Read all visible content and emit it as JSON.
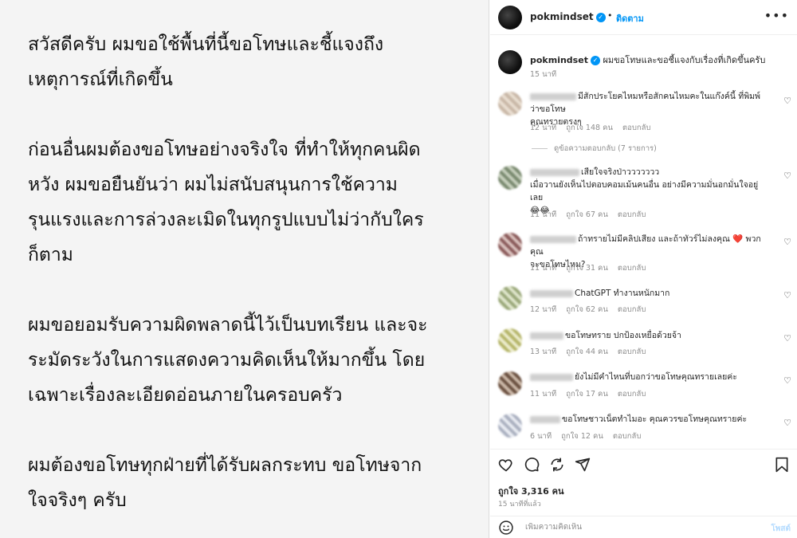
{
  "post_image": {
    "paragraphs": [
      [
        "สวัสดีครับ ผมขอใช้พื้นที่นี้ขอโทษและชี้แจงถึง",
        "เหตุการณ์ที่เกิดขึ้น"
      ],
      [
        "ก่อนอื่นผมต้องขอโทษอย่างจริงใจ ที่ทำให้ทุกคนผิด",
        "หวัง ผมขอยืนยันว่า ผมไม่สนับสนุนการใช้ความ",
        "รุนแรงและการล่วงละเมิดในทุกรูปแบบไม่ว่ากับใคร",
        "ก็ตาม"
      ],
      [
        "ผมขอยอมรับความผิดพลาดนี้ไว้เป็นบทเรียน และจะ",
        "ระมัดระวังในการแสดงความคิดเห็นให้มากขึ้น โดย",
        "เฉพาะเรื่องละเอียดอ่อนภายในครอบครัว"
      ],
      [
        "ผมต้องขอโทษทุกฝ่ายที่ได้รับผลกระทบ ขอโทษจาก",
        "ใจจริงๆ ครับ"
      ]
    ]
  },
  "header": {
    "username": "pokmindset",
    "separator": "•",
    "follow_label": "ติดตาม",
    "more": "•••"
  },
  "caption": {
    "username": "pokmindset",
    "text": "ผมขอโทษและขอชี้แจงกับเรื่องที่เกิดขึ้นครับ",
    "time": "15 นาที"
  },
  "comments": [
    {
      "lines": [
        "มีสักประโยคไหมหรือสักคนไหมคะในแก๊งค์นี้ ที่พิมพ์ว่าขอโทษ",
        "คุณทรายตรงๆ"
      ],
      "time": "12 นาที",
      "likes": "ถูกใจ 148 คน",
      "reply": "ตอบกลับ"
    },
    {
      "lines": [
        "เสียใจจริงป่าววววววว",
        "เมื่อวานยังเห็นไปตอบคอมเม้นคนอื่น อย่างมีความมั่นอกมั่นใจอยู่เลย",
        "😂😂"
      ],
      "time": "11 นาที",
      "likes": "ถูกใจ 67 คน",
      "reply": "ตอบกลับ"
    },
    {
      "lines": [
        "ถ้าทรายไม่มีคลิปเสียง และถ้าทัวร์ไม่ลงคุณ ❤️ พวกคุณ",
        "จะขอโทษไหม?"
      ],
      "time": "11 นาที",
      "likes": "ถูกใจ 31 คน",
      "reply": "ตอบกลับ"
    },
    {
      "lines": [
        "ChatGPT ทำงานหนักมาก"
      ],
      "time": "12 นาที",
      "likes": "ถูกใจ 62 คน",
      "reply": "ตอบกลับ"
    },
    {
      "lines": [
        "ขอโทษทราย ปกป้องเหยื่อด้วยจ้า"
      ],
      "time": "13 นาที",
      "likes": "ถูกใจ 44 คน",
      "reply": "ตอบกลับ"
    },
    {
      "lines": [
        "ยังไม่มีคำไหนที่บอกว่าขอโทษคุณทรายเลยค่ะ"
      ],
      "time": "11 นาที",
      "likes": "ถูกใจ 17 คน",
      "reply": "ตอบกลับ"
    },
    {
      "lines": [
        "ขอโทษชาวเน็ตทำไมอะ คุณควรขอโทษคุณทรายค่ะ"
      ],
      "time": "6 นาที",
      "likes": "ถูกใจ 12 คน",
      "reply": "ตอบกลับ"
    }
  ],
  "view_replies": "ดูข้อความตอบกลับ (7 รายการ)",
  "footer": {
    "likes": "ถูกใจ 3,316 คน",
    "time_ago": "15 นาทีที่แล้ว",
    "comment_placeholder": "เพิ่มความคิดเห็น",
    "post_label": "โพสต์"
  },
  "colors": {
    "accent": "#0095f6",
    "verified": "#0095f6",
    "heart": "#e0245e"
  },
  "icons": [
    "heart-icon",
    "comment-icon",
    "share-icon",
    "send-icon",
    "bookmark-icon",
    "emoji-icon",
    "more-icon"
  ]
}
